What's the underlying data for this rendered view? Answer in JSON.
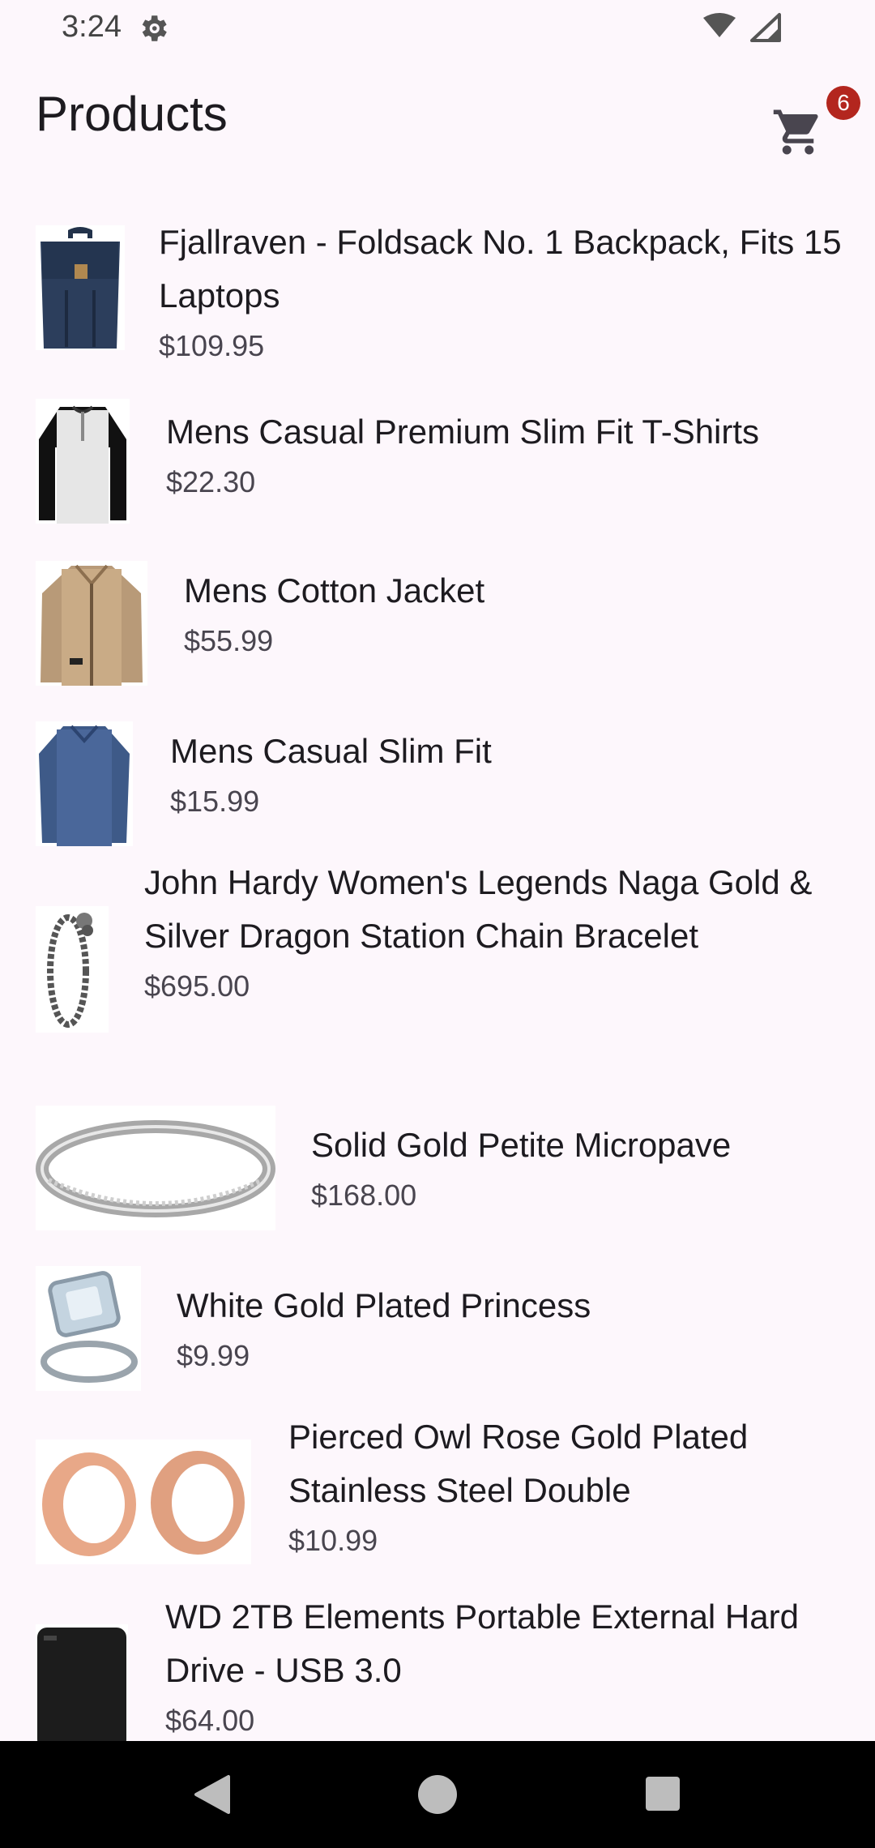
{
  "status_bar": {
    "time": "3:24",
    "icons": [
      "settings-gear-icon",
      "wifi-icon",
      "cell-signal-icon"
    ]
  },
  "app_bar": {
    "title": "Products",
    "cart_icon": "shopping-cart-icon",
    "cart_count": "6"
  },
  "products": [
    {
      "title": "Fjallraven - Foldsack No. 1 Backpack, Fits 15 Laptops",
      "price": "$109.95",
      "image": "backpack"
    },
    {
      "title": "Mens Casual Premium Slim Fit T-Shirts",
      "price": "$22.30",
      "image": "t-shirt"
    },
    {
      "title": "Mens Cotton Jacket",
      "price": "$55.99",
      "image": "jacket"
    },
    {
      "title": "Mens Casual Slim Fit",
      "price": "$15.99",
      "image": "long-sleeve-shirt"
    },
    {
      "title": "John Hardy Women's Legends Naga Gold & Silver Dragon Station Chain Bracelet",
      "price": "$695.00",
      "image": "bracelet"
    },
    {
      "title": "Solid Gold Petite Micropave",
      "price": "$168.00",
      "image": "ring"
    },
    {
      "title": "White Gold Plated Princess",
      "price": "$9.99",
      "image": "diamond-ring"
    },
    {
      "title": "Pierced Owl Rose Gold Plated Stainless Steel Double",
      "price": "$10.99",
      "image": "ear-tunnels"
    },
    {
      "title": "WD 2TB Elements Portable External Hard Drive - USB 3.0",
      "price": "$64.00",
      "image": "hard-drive"
    }
  ],
  "nav_bar": {
    "back_icon": "back-triangle-icon",
    "home_icon": "home-circle-icon",
    "recents_icon": "recents-square-icon"
  },
  "colors": {
    "background": "#fdf7fc",
    "badge": "#b3261e",
    "text_primary": "#1d1b20",
    "text_secondary": "#49454f"
  }
}
